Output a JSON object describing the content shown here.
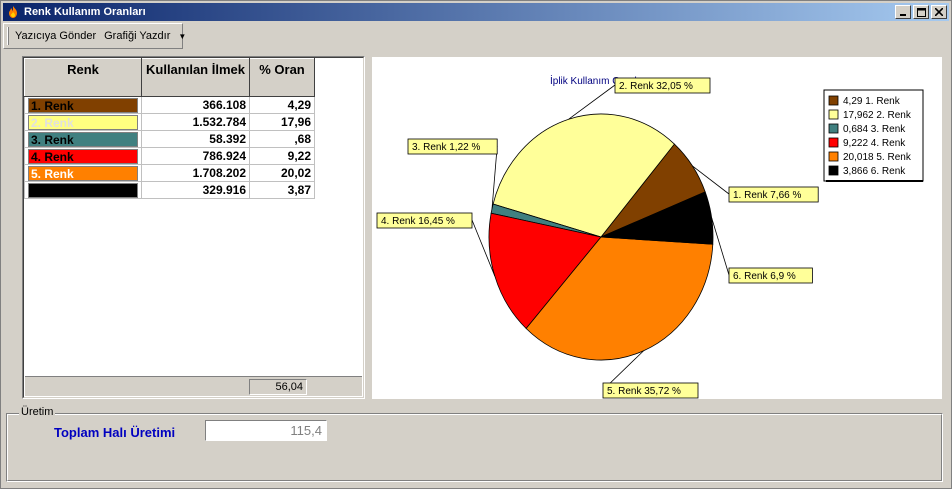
{
  "window": {
    "title": "Renk Kullanım Oranları"
  },
  "toolbar": {
    "send_label": "Yazıcıya Gönder",
    "print_label": "Grafiği Yazdır"
  },
  "table": {
    "headers": [
      "Renk",
      "Kullanılan İlmek",
      "% Oran"
    ],
    "rows": [
      {
        "name": "1. Renk",
        "color": "#804000",
        "text_color": "#000000",
        "ilmek": "366.108",
        "oran": "4,29"
      },
      {
        "name": "2. Renk",
        "color": "#ffff80",
        "text_color": "#e0e0e0",
        "ilmek": "1.532.784",
        "oran": "17,96"
      },
      {
        "name": "3. Renk",
        "color": "#408080",
        "text_color": "#000000",
        "ilmek": "58.392",
        "oran": ",68"
      },
      {
        "name": "4. Renk",
        "color": "#ff0000",
        "text_color": "#000000",
        "ilmek": "786.924",
        "oran": "9,22"
      },
      {
        "name": "5. Renk",
        "color": "#ff8000",
        "text_color": "#ffffff",
        "ilmek": "1.708.202",
        "oran": "20,02"
      },
      {
        "name": "",
        "color": "#000000",
        "text_color": "#ffffff",
        "ilmek": "329.916",
        "oran": "3,87"
      }
    ],
    "total": "56,04"
  },
  "chart_data": {
    "type": "pie",
    "title": "İplik Kullanım Oranları",
    "slices": [
      {
        "label": "1. Renk 7,66 %",
        "value": 7.66,
        "color": "#804000"
      },
      {
        "label": "2. Renk 32,05 %",
        "value": 32.05,
        "color": "#ffff99"
      },
      {
        "label": "3. Renk 1,22 %",
        "value": 1.22,
        "color": "#408080"
      },
      {
        "label": "4. Renk 16,45 %",
        "value": 16.45,
        "color": "#ff0000"
      },
      {
        "label": "5. Renk 35,72 %",
        "value": 35.72,
        "color": "#ff8000"
      },
      {
        "label": "6. Renk 6,9 %",
        "value": 6.9,
        "color": "#000000"
      }
    ],
    "legend": {
      "placement": "top-right",
      "entries": [
        "4,29 1. Renk",
        "17,962 2. Renk",
        "0,684 3. Renk",
        "9,222 4. Renk",
        "20,018 5. Renk",
        "3,866 6. Renk"
      ]
    }
  },
  "production": {
    "group_label": "Üretim",
    "total_label": "Toplam Halı Üretimi",
    "total_value": "115,4"
  }
}
